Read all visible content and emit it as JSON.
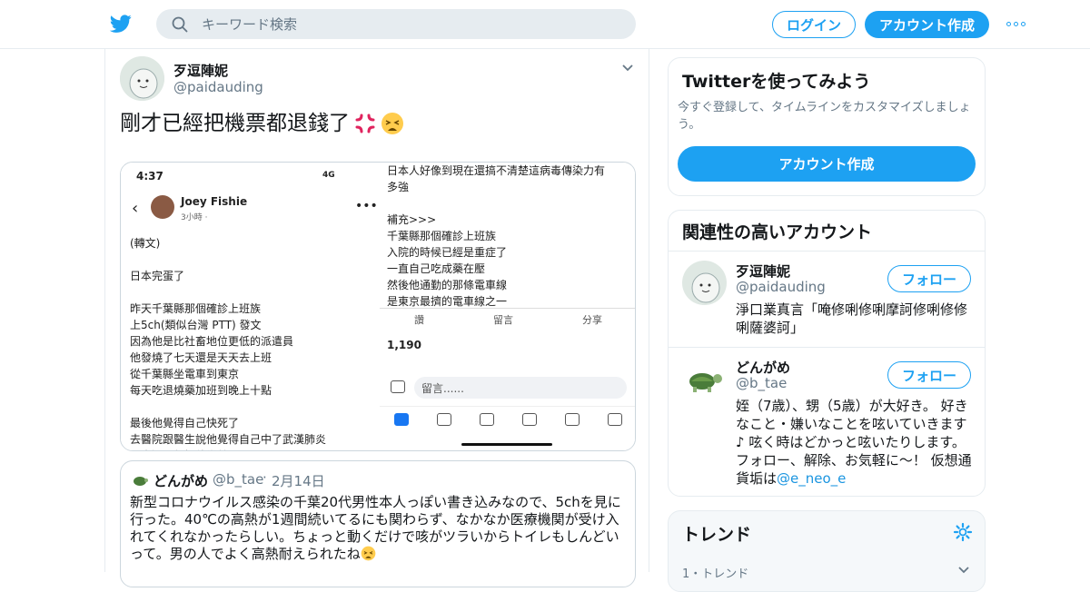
{
  "topbar": {
    "search_placeholder": "キーワード検索",
    "login_label": "ログイン",
    "signup_label": "アカウント作成"
  },
  "tweet": {
    "name": "歹逗陣妮",
    "handle": "@paidauding",
    "text": "剛才已經把機票都退錢了",
    "media": {
      "left": {
        "time": "4:37",
        "status": "4G",
        "user": "Joey Fishie",
        "meta": "3小時 · ",
        "lines": "(轉文)\n\n日本完蛋了\n\n昨天千葉縣那個確診上班族\n上5ch(類似台灣 PTT) 發文\n因為他是比社畜地位更低的派遣員\n他發燒了七天還是天天去上班\n從千葉縣坐電車到東京\n每天吃退燒藥加班到晚上十點\n\n最後他覺得自己快死了\n去醫院跟醫生說他覺得自己中了武漢肺炎\n醫生還只想把他當普通肺炎"
      },
      "right": {
        "lines": "日本人好像到現在還搞不清楚這病毒傳染力有\n多強\n\n補充>>>\n千葉縣那個確診上班族\n入院的時候已經是重症了\n一直自己吃成藥在壓\n然後他通勤的那條電車線\n是東京最擠的電車線之一",
        "like": "讚",
        "comment": "留言",
        "share": "分享",
        "reactions": "1,190",
        "comment_placeholder": "留言......"
      }
    },
    "quote": {
      "name": "どんがめ",
      "handle": "@b_tae",
      "dot": "·",
      "date": "2月14日",
      "text": "新型コロナウイルス感染の千葉20代男性本人っぽい書き込みなので、5chを見に行った。40℃の高熱が1週間続いてるにも関わらず、なかなか医療機関が受け入れてくれなかったらしい。ちょっと動くだけで咳がツラいからトイレもしんどいって。男の人でよく高熱耐えられたね"
    }
  },
  "sidebar": {
    "signup_card": {
      "title": "Twitterを使ってみよう",
      "subtitle": "今すぐ登録して、タイムラインをカスタマイズしましょう。",
      "button": "アカウント作成"
    },
    "relevant": {
      "title": "関連性の高いアカウント",
      "accounts": [
        {
          "name": "歹逗陣妮",
          "handle": "@paidauding",
          "bio": "淨口業真言「唵修唎修唎摩訶修唎修修唎薩婆訶」",
          "follow": "フォロー"
        },
        {
          "name": "どんがめ",
          "handle": "@b_tae",
          "bio": "姪（7歳）、甥（5歳）が大好き。 好きなこと・嫌いなことを呟いていきます♪ 呟く時はどかっと呟いたりします。フォロー、解除、お気軽に～！ 仮想通貨垢は",
          "bio_link": "@e_neo_e",
          "follow": "フォロー"
        }
      ]
    },
    "trends": {
      "title": "トレンド",
      "first_item": "1・トレンド"
    }
  },
  "colors": {
    "accent": "#1da1f2",
    "border": "#e6ecf0",
    "muted": "#657786"
  }
}
